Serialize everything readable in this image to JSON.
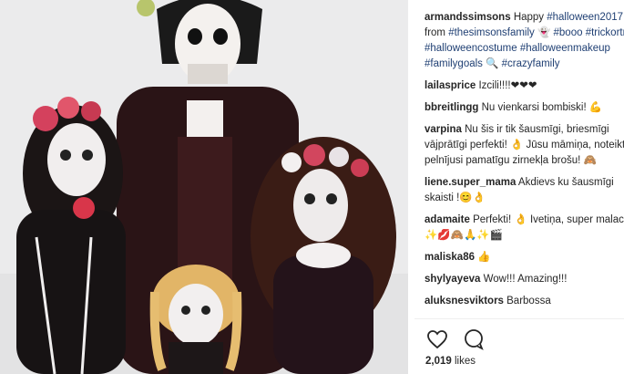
{
  "post": {
    "author": "armandssimsons",
    "caption": [
      {
        "t": "text",
        "v": "Happy "
      },
      {
        "t": "tag",
        "v": "#halloween2017"
      },
      {
        "t": "text",
        "v": " from "
      },
      {
        "t": "tag",
        "v": "#thesimsonsfamily"
      },
      {
        "t": "text",
        "v": " 👻 "
      },
      {
        "t": "tag",
        "v": "#booo"
      },
      {
        "t": "text",
        "v": " "
      },
      {
        "t": "tag",
        "v": "#trickortreat"
      },
      {
        "t": "text",
        "v": " "
      },
      {
        "t": "tag",
        "v": "#halloweencostume"
      },
      {
        "t": "text",
        "v": " "
      },
      {
        "t": "tag",
        "v": "#halloweenmakeup"
      },
      {
        "t": "text",
        "v": " "
      },
      {
        "t": "tag",
        "v": "#familygoals"
      },
      {
        "t": "text",
        "v": " 🔍 "
      },
      {
        "t": "tag",
        "v": "#crazyfamily"
      }
    ],
    "likes_count": "2,019",
    "likes_label": "likes"
  },
  "comments": [
    {
      "user": "lailasprice",
      "text": "Izcili!!!!❤❤❤"
    },
    {
      "user": "bbreitlingg",
      "text": "Nu vienkarsi bombiski! 💪"
    },
    {
      "user": "varpina",
      "text": "Nu šis ir tik šausmīgi, briesmīgi vājprātīgi perfekti! 👌 Jūsu māmiņa, noteikti pelnījusi pamatīgu zirnekļa brošu! 🙈"
    },
    {
      "user": "liene.super_mama",
      "text": "Akdievs ku šausmīgi skaisti !😊👌"
    },
    {
      "user": "adamaite",
      "text": "Perfekti! 👌 Ivetiņa, super malacis!✨💋🙈🙏✨🎬"
    },
    {
      "user": "maliska86",
      "text": "👍"
    },
    {
      "user": "shylyayeva",
      "text": "Wow!!! Amazing!!!"
    },
    {
      "user": "aluksnesviktors",
      "text": "Barbossa"
    }
  ],
  "icons": [
    "heart-icon",
    "comment-icon"
  ],
  "colors": {
    "text": "#262626",
    "hashtag": "#1f3f73",
    "divider": "#efefef"
  }
}
